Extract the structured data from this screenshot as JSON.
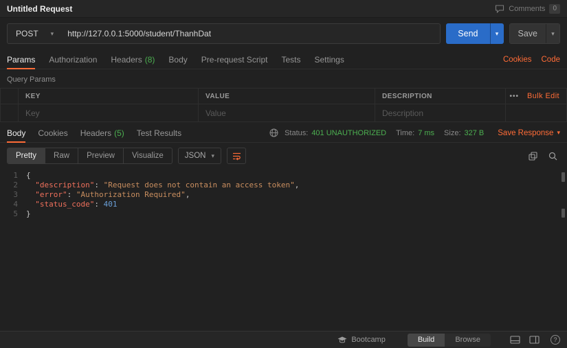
{
  "colors": {
    "accent_orange": "#ff6c37",
    "send_blue": "#2a6cc8",
    "status_green": "#4caf50"
  },
  "icons": {
    "chevron_down": "▾",
    "more": "•••",
    "help": "?"
  },
  "topbar": {
    "title": "Untitled Request",
    "comments_label": "Comments",
    "comments_count": "0"
  },
  "request": {
    "method": "POST",
    "url": "http://127.0.0.1:5000/student/ThanhDat",
    "send_label": "Send",
    "save_label": "Save"
  },
  "request_tabs": {
    "params": "Params",
    "authorization": "Authorization",
    "headers": "Headers",
    "headers_count": "(8)",
    "body": "Body",
    "prerequest": "Pre-request Script",
    "tests": "Tests",
    "settings": "Settings",
    "cookies_link": "Cookies",
    "code_link": "Code"
  },
  "query_params": {
    "title": "Query Params",
    "col_key": "KEY",
    "col_value": "VALUE",
    "col_description": "DESCRIPTION",
    "bulk_edit": "Bulk Edit",
    "placeholder_key": "Key",
    "placeholder_value": "Value",
    "placeholder_description": "Description"
  },
  "response": {
    "tab_body": "Body",
    "tab_cookies": "Cookies",
    "tab_headers": "Headers",
    "headers_count": "(5)",
    "tab_test_results": "Test Results",
    "status_label": "Status:",
    "status_value": "401 UNAUTHORIZED",
    "time_label": "Time:",
    "time_value": "7 ms",
    "size_label": "Size:",
    "size_value": "327 B",
    "save_response": "Save Response",
    "view_pretty": "Pretty",
    "view_raw": "Raw",
    "view_preview": "Preview",
    "view_visualize": "Visualize",
    "format": "JSON",
    "code_lines": [
      {
        "num": "1",
        "tokens": [
          {
            "t": "{",
            "c": "punc"
          }
        ]
      },
      {
        "num": "2",
        "tokens": [
          {
            "t": "  ",
            "c": "punc"
          },
          {
            "t": "\"description\"",
            "c": "key"
          },
          {
            "t": ": ",
            "c": "punc"
          },
          {
            "t": "\"Request does not contain an access token\"",
            "c": "str"
          },
          {
            "t": ",",
            "c": "punc"
          }
        ]
      },
      {
        "num": "3",
        "tokens": [
          {
            "t": "  ",
            "c": "punc"
          },
          {
            "t": "\"error\"",
            "c": "key"
          },
          {
            "t": ": ",
            "c": "punc"
          },
          {
            "t": "\"Authorization Required\"",
            "c": "str"
          },
          {
            "t": ",",
            "c": "punc"
          }
        ]
      },
      {
        "num": "4",
        "tokens": [
          {
            "t": "  ",
            "c": "punc"
          },
          {
            "t": "\"status_code\"",
            "c": "key"
          },
          {
            "t": ": ",
            "c": "punc"
          },
          {
            "t": "401",
            "c": "num"
          }
        ]
      },
      {
        "num": "5",
        "tokens": [
          {
            "t": "}",
            "c": "punc"
          }
        ]
      }
    ]
  },
  "footer": {
    "bootcamp": "Bootcamp",
    "build": "Build",
    "browse": "Browse"
  }
}
